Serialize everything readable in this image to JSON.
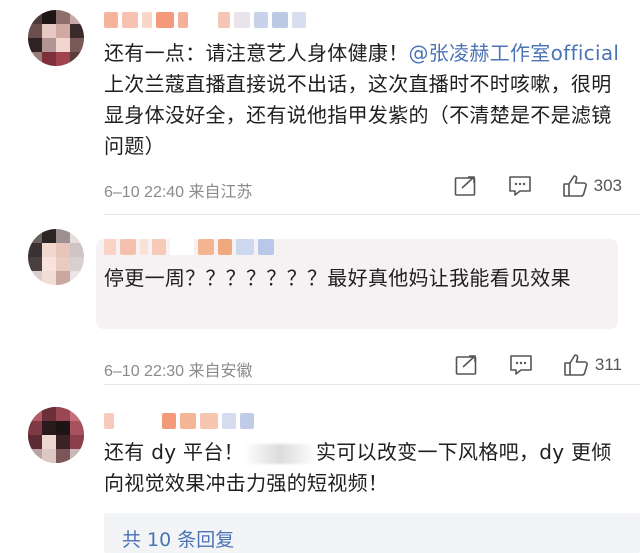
{
  "comments": [
    {
      "text_pre": "还有一点：请注意艺人身体健康！",
      "mention": "@张凌赫工作室official",
      "text_post": " 上次兰蔻直播直接说不出话，这次直播时不时咳嗽，很明显身体没好全，还有说他指甲发紫的（不清楚是不是滤镜问题）",
      "meta": "6–10 22:40 来自江苏",
      "likes": "303"
    },
    {
      "text": "停更一周？？？？？？？最好真他妈让我能看见效果",
      "meta": "6–10 22:30 来自安徽",
      "likes": "311"
    },
    {
      "text_pre": "还有 dy 平台！",
      "text_post": "实可以改变一下风格吧，dy 更倾向视觉效果冲击力强的短视频！",
      "reply_link": "共 10 条回复"
    }
  ],
  "icons": {
    "share": "share-icon",
    "comment": "comment-icon",
    "like": "thumbs-up-icon"
  },
  "colors": {
    "mention": "#4b74b5",
    "meta": "#8a8a8a",
    "highlight": "#f6f2f4"
  }
}
